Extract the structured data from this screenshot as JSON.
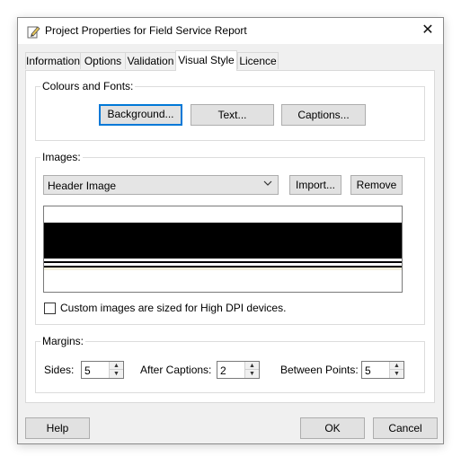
{
  "window": {
    "title": "Project Properties for Field Service Report"
  },
  "tabs": [
    {
      "label": "Information"
    },
    {
      "label": "Options"
    },
    {
      "label": "Validation"
    },
    {
      "label": "Visual Style"
    },
    {
      "label": "Licence"
    }
  ],
  "active_tab": "Visual Style",
  "colours_fonts": {
    "label": "Colours and Fonts:",
    "background_button": "Background...",
    "text_button": "Text...",
    "captions_button": "Captions..."
  },
  "images": {
    "label": "Images:",
    "selected_image": "Header Image",
    "import_button": "Import...",
    "remove_button": "Remove",
    "high_dpi_label": "Custom images are sized for High DPI devices.",
    "high_dpi_checked": false
  },
  "margins": {
    "label": "Margins:",
    "sides_label": "Sides:",
    "sides_value": "5",
    "after_captions_label": "After Captions:",
    "after_captions_value": "2",
    "between_points_label": "Between Points:",
    "between_points_value": "5"
  },
  "footer": {
    "help_button": "Help",
    "ok_button": "OK",
    "cancel_button": "Cancel"
  },
  "icons": {
    "title_icon": "pencil-document-icon",
    "close": "close-icon",
    "dropdown": "chevron-down-icon",
    "spin_up": "spin-up-icon",
    "spin_down": "spin-down-icon"
  },
  "colors": {
    "accent": "#0078d7",
    "header_band": "#000000",
    "header_cream": "#f3efdc"
  }
}
